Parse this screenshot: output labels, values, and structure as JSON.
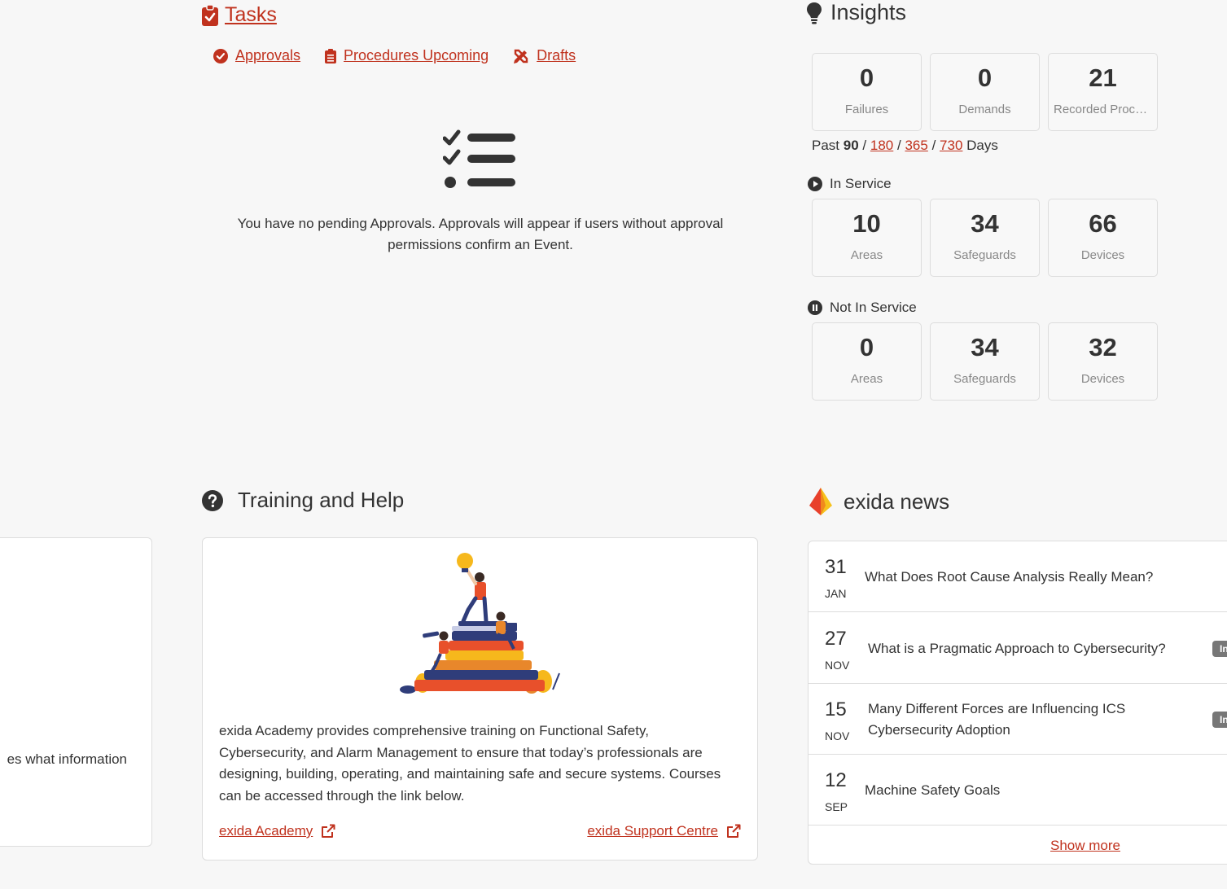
{
  "tasks": {
    "title": "Tasks",
    "links": {
      "approvals": "Approvals",
      "procedures_upcoming": "Procedures Upcoming",
      "drafts": "Drafts"
    },
    "empty_message": "You have no pending Approvals. Approvals will appear if users without approval permissions confirm an Event."
  },
  "insights": {
    "title": "Insights",
    "summary": [
      {
        "value": "0",
        "label": "Failures"
      },
      {
        "value": "0",
        "label": "Demands"
      },
      {
        "value": "21",
        "label": "Recorded Procedures"
      }
    ],
    "period": {
      "prefix": "Past",
      "selected": "90",
      "options": [
        "180",
        "365",
        "730"
      ],
      "suffix": "Days",
      "sep": "/"
    },
    "in_service": {
      "label": "In Service",
      "cards": [
        {
          "value": "10",
          "label": "Areas"
        },
        {
          "value": "34",
          "label": "Safeguards"
        },
        {
          "value": "66",
          "label": "Devices"
        }
      ]
    },
    "not_in_service": {
      "label": "Not In Service",
      "cards": [
        {
          "value": "0",
          "label": "Areas"
        },
        {
          "value": "34",
          "label": "Safeguards"
        },
        {
          "value": "32",
          "label": "Devices"
        }
      ]
    }
  },
  "left_card": {
    "fragment": "es what information"
  },
  "training": {
    "title": "Training and Help",
    "description": "exida Academy provides comprehensive training on Functional Safety, Cybersecurity, and Alarm Management to ensure that today’s professionals are designing, building, operating, and maintaining safe and secure systems. Courses can be accessed through the link below.",
    "academy_link": "exida Academy",
    "support_link": "exida Support Centre"
  },
  "news": {
    "title": "exida news",
    "items": [
      {
        "day": "31",
        "month": "JAN",
        "title": "What Does Root Cause Analysis Really Mean?",
        "badge": ""
      },
      {
        "day": "27",
        "month": "NOV",
        "title": "What is a Pragmatic Approach to Cybersecurity?",
        "badge": "In"
      },
      {
        "day": "15",
        "month": "NOV",
        "title": "Many Different Forces are Influencing ICS Cybersecurity Adoption",
        "badge": "In"
      },
      {
        "day": "12",
        "month": "SEP",
        "title": "Machine Safety Goals",
        "badge": ""
      }
    ],
    "show_more": "Show more"
  },
  "colors": {
    "accent": "#c0321e",
    "text": "#333333",
    "muted": "#888888",
    "border": "#dddddd"
  }
}
